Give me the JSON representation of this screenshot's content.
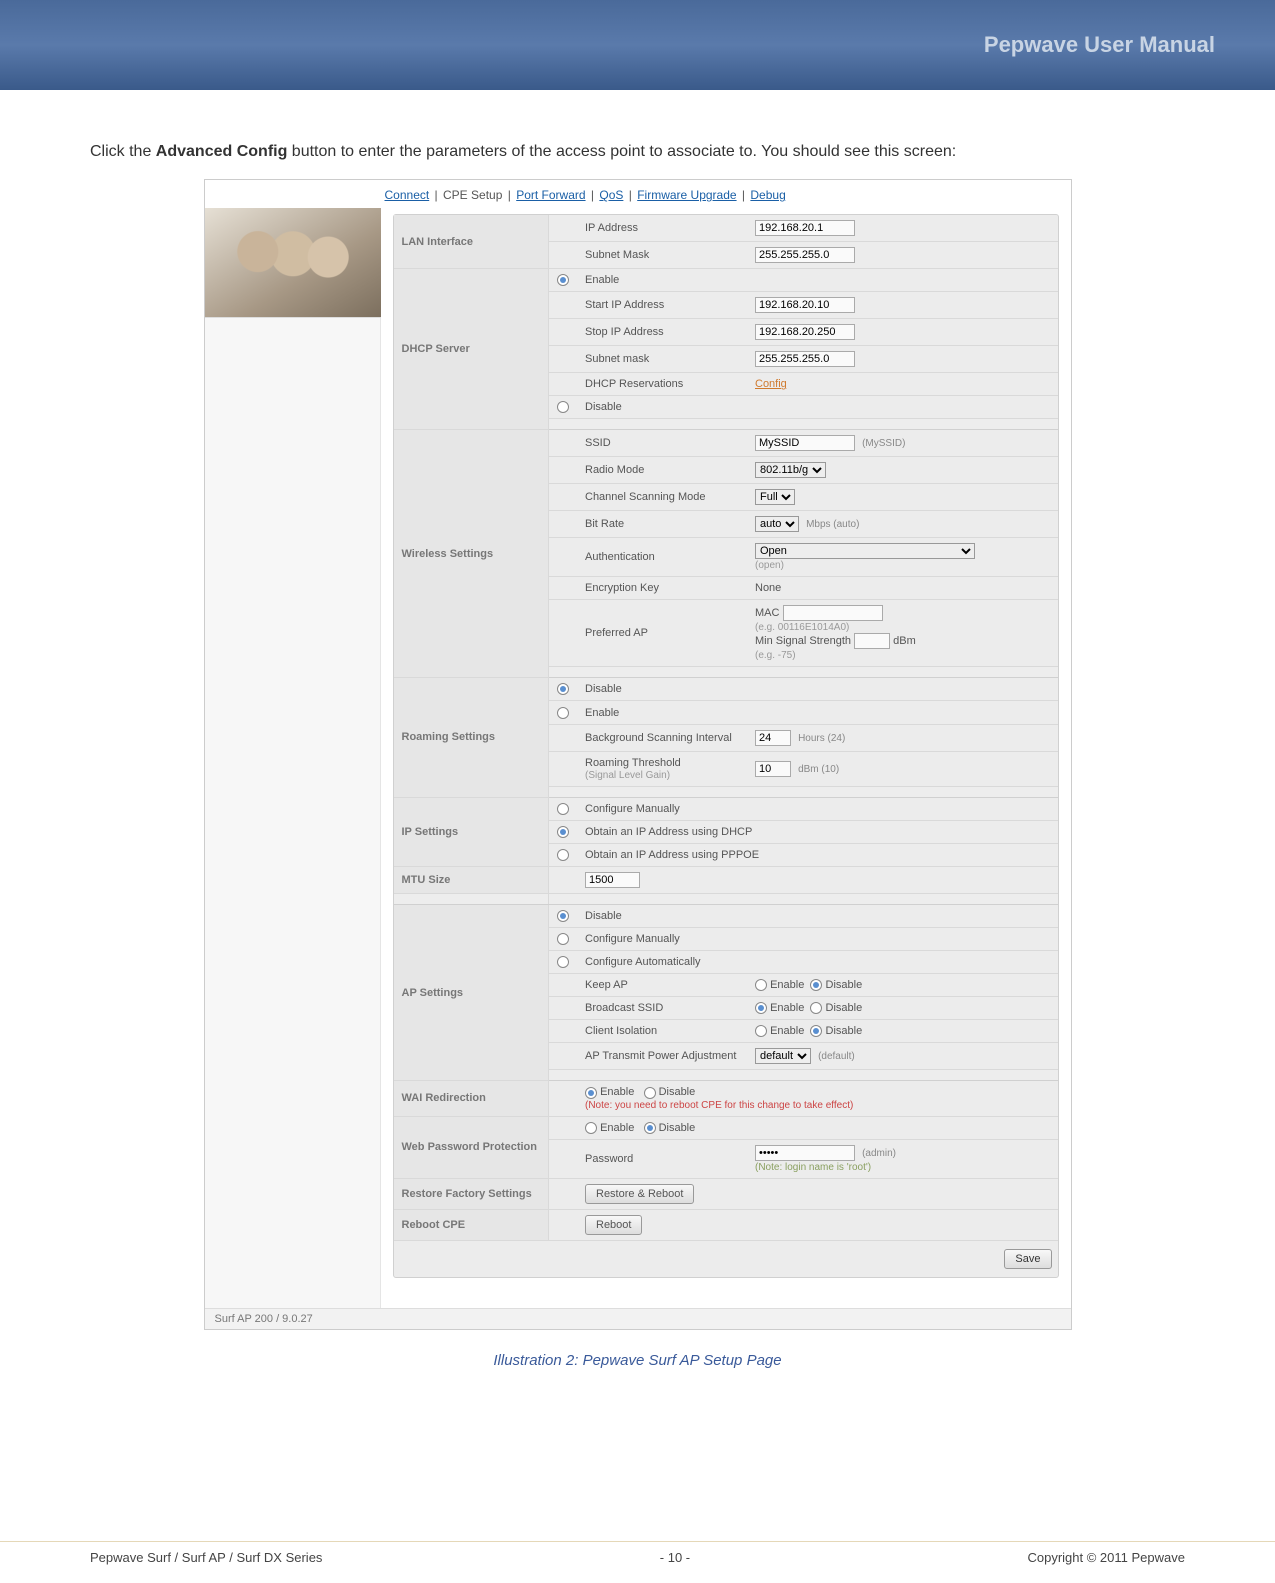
{
  "header": {
    "title": "Pepwave User Manual"
  },
  "intro": {
    "pre": "Click the ",
    "bold": "Advanced Config",
    "post": " button to enter the parameters of the access point to associate to.  You should see this screen:"
  },
  "topnav": {
    "items": [
      "Connect",
      "CPE Setup",
      "Port Forward",
      "QoS",
      "Firmware Upgrade",
      "Debug"
    ],
    "link_flags": [
      true,
      false,
      true,
      true,
      true,
      true
    ]
  },
  "lan": {
    "section": "LAN Interface",
    "ip_label": "IP Address",
    "ip_value": "192.168.20.1",
    "subnet_label": "Subnet Mask",
    "subnet_value": "255.255.255.0"
  },
  "dhcp": {
    "section": "DHCP Server",
    "enable": "Enable",
    "disable": "Disable",
    "start_label": "Start IP Address",
    "start_value": "192.168.20.10",
    "stop_label": "Stop IP Address",
    "stop_value": "192.168.20.250",
    "mask_label": "Subnet mask",
    "mask_value": "255.255.255.0",
    "res_label": "DHCP Reservations",
    "res_link": "Config"
  },
  "wifi": {
    "section": "Wireless Settings",
    "ssid_label": "SSID",
    "ssid_value": "MySSID",
    "ssid_hint": "(MySSID)",
    "radio_label": "Radio Mode",
    "radio_value": "802.11b/g",
    "scan_label": "Channel Scanning Mode",
    "scan_value": "Full",
    "bitrate_label": "Bit Rate",
    "bitrate_value": "auto",
    "bitrate_hint": "Mbps (auto)",
    "auth_label": "Authentication",
    "auth_value": "Open",
    "auth_hint": "(open)",
    "enc_label": "Encryption Key",
    "enc_value": "None",
    "pref_label": "Preferred AP",
    "mac_label": "MAC",
    "mac_hint": "(e.g. 00116E1014A0)",
    "minsig_label": "Min Signal Strength",
    "minsig_unit": "dBm",
    "minsig_hint": "(e.g. -75)"
  },
  "roam": {
    "section": "Roaming Settings",
    "disable": "Disable",
    "enable": "Enable",
    "bg_label": "Background Scanning Interval",
    "bg_value": "24",
    "bg_hint": "Hours (24)",
    "thr_label": "Roaming Threshold",
    "thr_sub": "(Signal Level Gain)",
    "thr_value": "10",
    "thr_hint": "dBm (10)"
  },
  "ip": {
    "section": "IP Settings",
    "manual": "Configure Manually",
    "dhcp": "Obtain an IP Address using DHCP",
    "pppoe": "Obtain an IP Address using PPPOE"
  },
  "mtu": {
    "section": "MTU Size",
    "value": "1500"
  },
  "ap": {
    "section": "AP Settings",
    "disable": "Disable",
    "conf_man": "Configure Manually",
    "conf_auto": "Configure Automatically",
    "keep_label": "Keep AP",
    "enable_label": "Enable",
    "disable_label": "Disable",
    "bcast_label": "Broadcast SSID",
    "iso_label": "Client Isolation",
    "tx_label": "AP Transmit Power Adjustment",
    "tx_value": "default",
    "tx_hint": "(default)"
  },
  "wai": {
    "section": "WAI Redirection",
    "enable": "Enable",
    "disable": "Disable",
    "note": "(Note: you need to reboot CPE for this change to take effect)"
  },
  "web": {
    "section": "Web Password Protection",
    "enable": "Enable",
    "disable": "Disable",
    "pw_label": "Password",
    "pw_value": "•••••",
    "pw_hint": "(admin)",
    "pw_note": "(Note: login name is 'root')"
  },
  "restore": {
    "section": "Restore Factory Settings",
    "btn": "Restore & Reboot"
  },
  "reboot": {
    "section": "Reboot CPE",
    "btn": "Reboot"
  },
  "save_btn": "Save",
  "footer_line": "Surf AP 200 / 9.0.27",
  "caption": "Illustration 2: Pepwave Surf AP Setup Page",
  "pagefoot": {
    "left": "Pepwave Surf / Surf AP / Surf DX Series",
    "center": "- 10 -",
    "right": "Copyright © 2011 Pepwave"
  }
}
